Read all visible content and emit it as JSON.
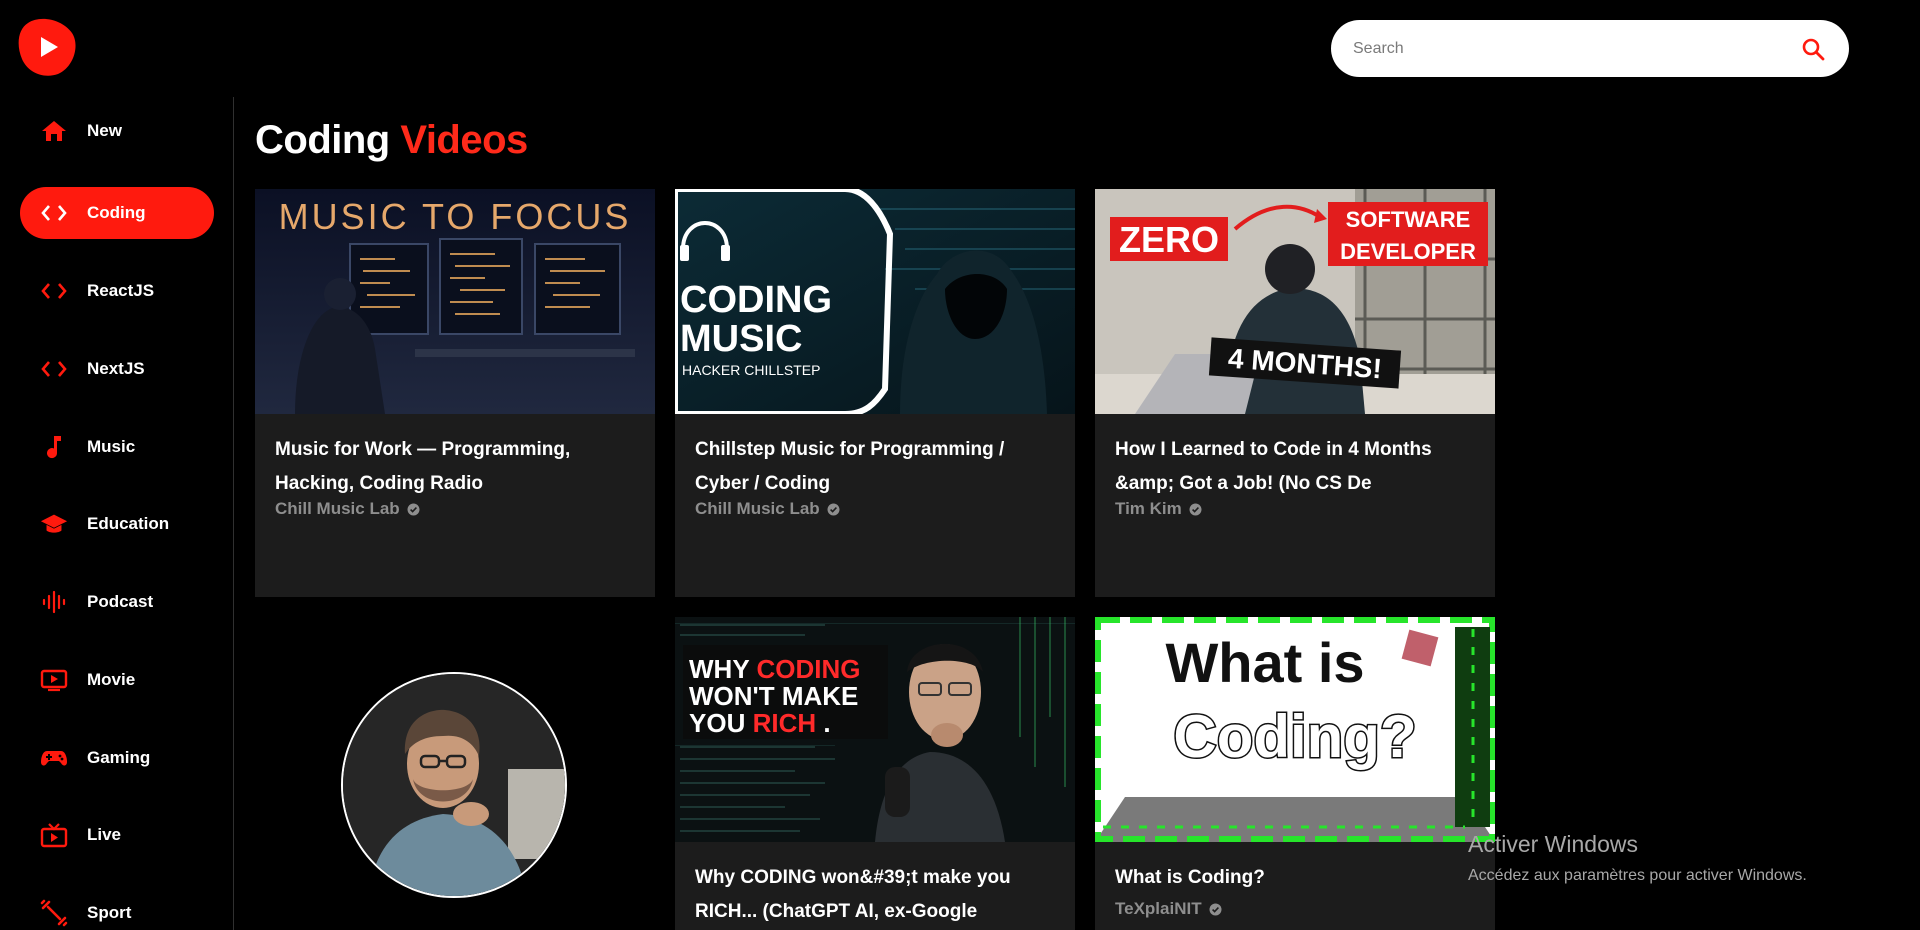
{
  "app": {
    "logo_icon": "play-logo-icon",
    "accent_color": "#ff1a0e"
  },
  "search": {
    "placeholder": "Search",
    "icon": "search-icon"
  },
  "sidebar": {
    "items": [
      {
        "label": "New",
        "icon": "home-icon",
        "active": false
      },
      {
        "label": "Coding",
        "icon": "code-icon",
        "active": true
      },
      {
        "label": "ReactJS",
        "icon": "code-icon",
        "active": false
      },
      {
        "label": "NextJS",
        "icon": "code-icon",
        "active": false
      },
      {
        "label": "Music",
        "icon": "music-note-icon",
        "active": false
      },
      {
        "label": "Education",
        "icon": "graduation-cap-icon",
        "active": false
      },
      {
        "label": "Podcast",
        "icon": "audio-wave-icon",
        "active": false
      },
      {
        "label": "Movie",
        "icon": "video-icon",
        "active": false
      },
      {
        "label": "Gaming",
        "icon": "gamepad-icon",
        "active": false
      },
      {
        "label": "Live",
        "icon": "live-tv-icon",
        "active": false
      },
      {
        "label": "Sport",
        "icon": "fitness-icon",
        "active": false
      }
    ]
  },
  "main": {
    "title_prefix": "Coding",
    "title_accent": "Videos",
    "videos": [
      {
        "thumb_text": "MUSIC TO FOCUS",
        "title_line1": "Music for Work — Programming,",
        "title_line2": "Hacking, Coding Radio",
        "channel": "Chill Music Lab"
      },
      {
        "thumb_text_1": "CODING",
        "thumb_text_2": "MUSIC",
        "thumb_text_3": "HACKER CHILLSTEP",
        "title_line1": "Chillstep Music for Programming /",
        "title_line2": "Cyber / Coding",
        "channel": "Chill Music Lab"
      },
      {
        "thumb_text_1": "ZERO",
        "thumb_text_2": "SOFTWARE",
        "thumb_text_3": "DEVELOPER",
        "thumb_text_4": "4 MONTHS!",
        "title_line1": "How I Learned to Code in 4 Months",
        "title_line2": "&amp; Got a Job! (No CS De",
        "channel": "Tim Kim"
      },
      {
        "thumb_text_1": "WHY",
        "thumb_text_2": "CODING",
        "thumb_text_3": "WON'T MAKE",
        "thumb_text_4": "YOU",
        "thumb_text_5": "RICH",
        "thumb_text_6": ".",
        "title_line1": "Why CODING won&#39;t make you",
        "title_line2": "RICH... (ChatGPT AI, ex-Google",
        "channel": ""
      },
      {
        "thumb_text_1": "What is",
        "thumb_text_2": "Coding?",
        "title_line1": "What is Coding?",
        "title_line2": "",
        "channel": "TeXplaiNIT"
      }
    ]
  },
  "watermark": {
    "title": "Activer Windows",
    "subtitle": "Accédez aux paramètres pour activer Windows."
  }
}
